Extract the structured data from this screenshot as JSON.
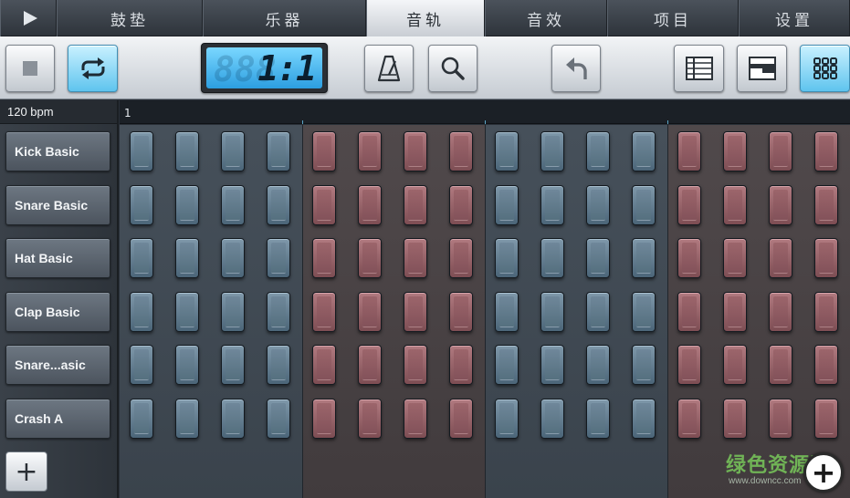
{
  "tabs": [
    {
      "label": "鼓垫",
      "active": false
    },
    {
      "label": "乐器",
      "active": false
    },
    {
      "label": "音轨",
      "active": true
    },
    {
      "label": "音效",
      "active": false
    },
    {
      "label": "项目",
      "active": false
    },
    {
      "label": "设置",
      "active": false
    }
  ],
  "toolbar": {
    "lcd_ghost": "888",
    "lcd_value": "1:1",
    "icons": [
      "stop-icon",
      "loop-icon",
      "metronome-icon",
      "search-icon",
      "undo-icon",
      "list-view-icon",
      "mixer-view-icon",
      "pad-grid-icon"
    ]
  },
  "sidebar": {
    "bpm": "120 bpm",
    "instruments": [
      "Kick Basic",
      "Snare Basic",
      "Hat Basic",
      "Clap Basic",
      "Snare...asic",
      "Crash A"
    ],
    "add_label": "+"
  },
  "timeline": {
    "bar_number": "1"
  },
  "grid": {
    "steps": 16,
    "beats": [
      "blue",
      "red",
      "blue",
      "red"
    ]
  },
  "colors": {
    "accent_blue": "#5fc4ee",
    "pad_blue": "#5f7a8d",
    "pad_red": "#96626a"
  },
  "watermark": {
    "text": "绿色资源网",
    "url": "www.downcc.com",
    "plus": "+"
  }
}
